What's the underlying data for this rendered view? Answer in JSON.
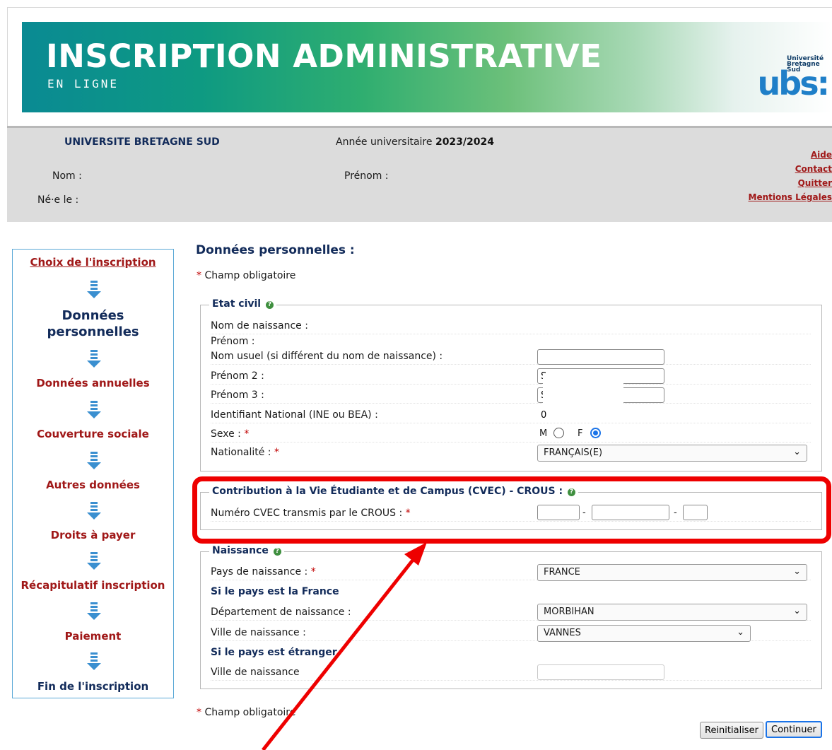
{
  "banner": {
    "title": "INSCRIPTION ADMINISTRATIVE",
    "subtitle": "EN LIGNE",
    "logo_small": "Université Bretagne Sud",
    "logo_text": "ubs:"
  },
  "header": {
    "university": "UNIVERSITE BRETAGNE SUD",
    "year_label": "Année universitaire ",
    "year_value": "2023/2024",
    "nom_label": "Nom :",
    "prenom_label": "Prénom :",
    "ne_label": "Né·e le :",
    "links": [
      "Aide",
      "Contact",
      "Quitter",
      "Mentions Légales"
    ]
  },
  "steps": [
    {
      "label": "Choix de l'inscription",
      "state": "done"
    },
    {
      "label": "Données personnelles",
      "state": "current"
    },
    {
      "label": "Données annuelles",
      "state": "todo"
    },
    {
      "label": "Couverture sociale",
      "state": "todo"
    },
    {
      "label": "Autres données",
      "state": "todo"
    },
    {
      "label": "Droits à payer",
      "state": "todo"
    },
    {
      "label": "Récapitulatif inscription",
      "state": "todo"
    },
    {
      "label": "Paiement",
      "state": "todo"
    },
    {
      "label": "Fin de l'inscription",
      "state": "last"
    }
  ],
  "main": {
    "title": "Données personnelles :",
    "required_note": "Champ obligatoire",
    "etat_civil": {
      "legend": "Etat civil",
      "nom_naissance": "Nom de naissance :",
      "prenom": "Prénom :",
      "nom_usuel": "Nom usuel (si différent du nom de naissance) :",
      "nom_usuel_value": "",
      "prenom2": "Prénom 2 :",
      "prenom2_value": "S",
      "prenom3": "Prénom 3 :",
      "prenom3_value": "S",
      "ine": "Identifiant National (INE ou BEA) :",
      "ine_value": "0",
      "sexe": "Sexe :",
      "sexe_m": "M",
      "sexe_f": "F",
      "sexe_selected": "F",
      "nationalite": "Nationalité :",
      "nationalite_value": "FRANÇAIS(E)"
    },
    "cvec": {
      "legend": "Contribution à la Vie Étudiante et de Campus (CVEC) - CROUS :",
      "numero": "Numéro CVEC transmis par le CROUS :",
      "sep": "-",
      "part1": "",
      "part2": "",
      "part3": ""
    },
    "naissance": {
      "legend": "Naissance",
      "pays": "Pays de naissance :",
      "pays_value": "FRANCE",
      "si_france": "Si le pays est la France",
      "departement": "Département de naissance :",
      "departement_value": "MORBIHAN",
      "ville": "Ville de naissance :",
      "ville_value": "VANNES",
      "si_etranger": "Si le pays est étranger",
      "ville_etranger": "Ville de naissance",
      "ville_etranger_value": ""
    },
    "buttons": {
      "reset": "Reinitialiser",
      "continue": "Continuer"
    }
  },
  "colors": {
    "annotation": "#ee0000",
    "nav_border": "#5aa8d6",
    "link_red": "#a01818",
    "title_navy": "#122b5a",
    "arrow_blue": "#3a8fd0"
  }
}
